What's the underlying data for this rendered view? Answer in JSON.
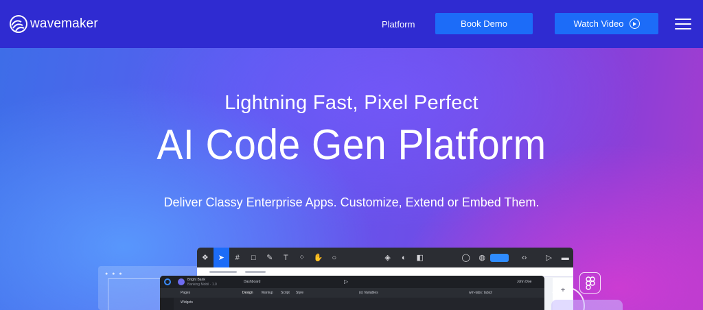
{
  "header": {
    "logo_text": "wavemaker",
    "nav_platform": "Platform",
    "book_demo_label": "Book Demo",
    "watch_video_label": "Watch Video"
  },
  "hero": {
    "subtitle": "Lightning Fast, Pixel Perfect",
    "title": "AI Code Gen Platform",
    "description": "Deliver Classy Enterprise Apps. Customize, Extend or Embed Them."
  },
  "studio": {
    "project_name": "Bright Bank",
    "project_sub": "Banking Mobil · 1.0",
    "page_name": "Dashboard",
    "user_name": "John Doe",
    "tab_design": "Design",
    "tab_markup": "Markup",
    "tab_script": "Script",
    "tab_style": "Style",
    "variables_label": "(x) Variables",
    "pages_label": "Pages",
    "widgets_label": "Widgets",
    "widget_path": "wm-tabs: tabs2"
  },
  "colors": {
    "nav_bg": "#2f2bd1",
    "button_blue": "#1c6cf8",
    "toolbar_dark": "#2b2d33"
  },
  "icons": {
    "logo": "wavemaker-wave-icon",
    "play": "play-circle-icon",
    "menu": "hamburger-menu-icon",
    "figma": "figma-icon"
  }
}
